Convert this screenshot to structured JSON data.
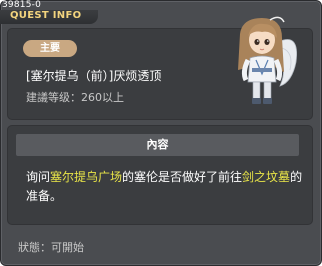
{
  "window": {
    "id_tag": "39815-0",
    "title": "QUEST INFO"
  },
  "quest": {
    "category_badge": "主要",
    "name": "[塞尔提乌（前）]厌烦透顶",
    "level_requirement": "建議等级：260以上"
  },
  "content": {
    "header": "內容",
    "text_segments": [
      {
        "text": "询问",
        "highlight": false
      },
      {
        "text": "塞尔提乌广场",
        "highlight": true
      },
      {
        "text": "的塞伦是否做好了前往",
        "highlight": false
      },
      {
        "text": "剑之坟墓",
        "highlight": true
      },
      {
        "text": "的准备。",
        "highlight": false
      }
    ]
  },
  "status": {
    "text": "狀態：可開始"
  },
  "colors": {
    "title": "#f3d47e",
    "highlight": "#e9e548",
    "badge": "#c9a882"
  }
}
